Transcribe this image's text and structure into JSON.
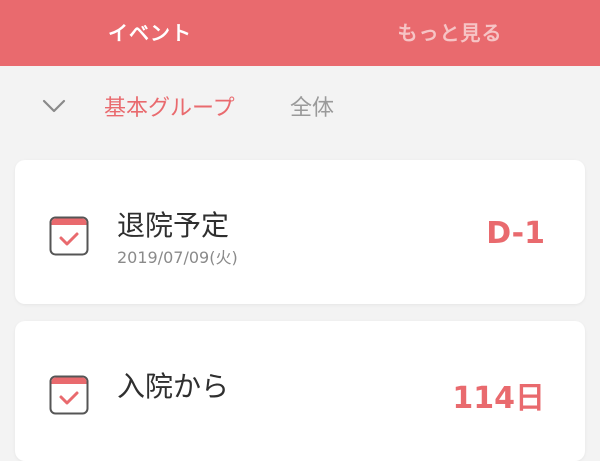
{
  "tabs": {
    "events": "イベント",
    "more": "もっと見る"
  },
  "groups": {
    "basic": "基本グループ",
    "all": "全体"
  },
  "events": [
    {
      "title": "退院予定",
      "date": "2019/07/09(火)",
      "badge": "D-1"
    },
    {
      "title": "入院から",
      "badge": "114日"
    }
  ],
  "colors": {
    "accent": "#e96a6e",
    "background": "#f3f3f3"
  },
  "icons": {
    "group_toggle": "chevron-down-icon",
    "event": "calendar-check-icon"
  }
}
